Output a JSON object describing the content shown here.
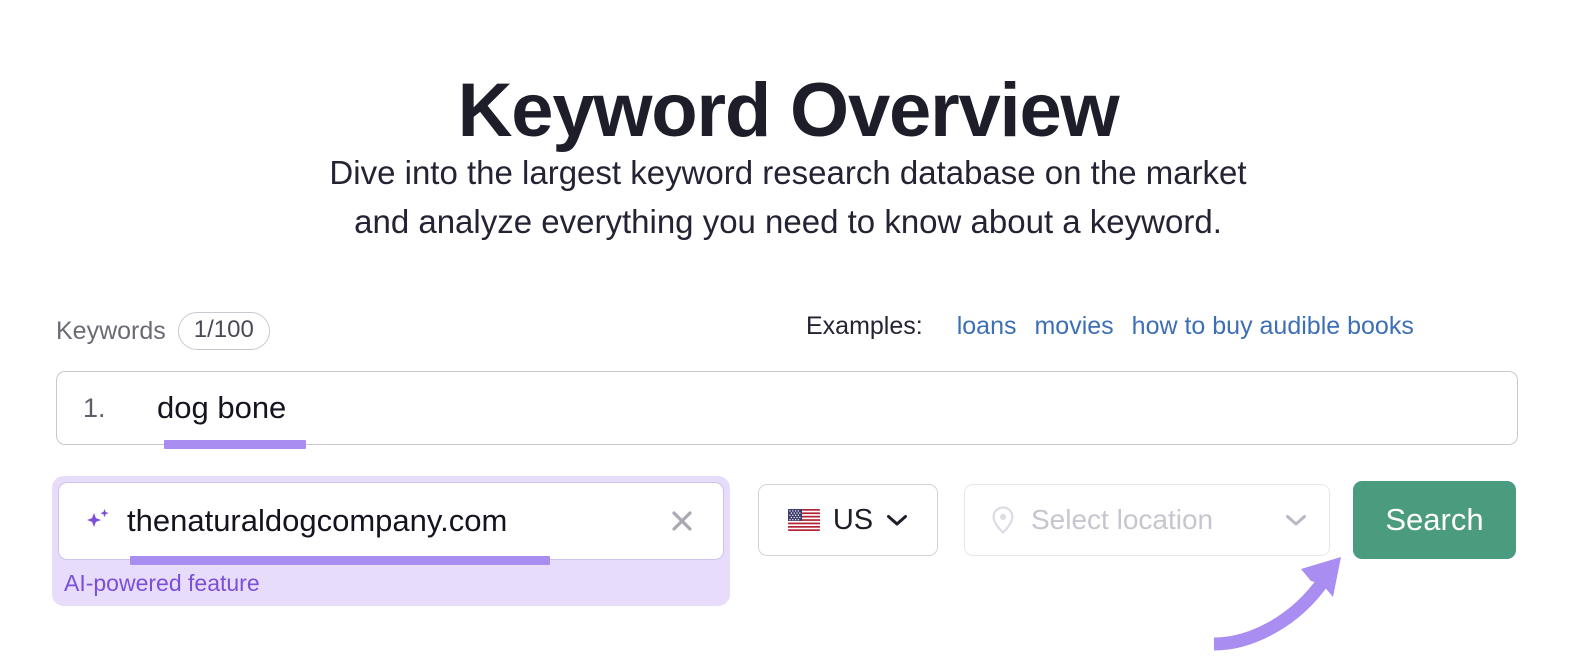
{
  "header": {
    "title": "Keyword Overview",
    "subtitle_line1": "Dive into the largest keyword research database on the market",
    "subtitle_line2": "and analyze everything you need to know about a keyword."
  },
  "keywords_section": {
    "label": "Keywords",
    "count_badge": "1/100",
    "rows": [
      {
        "index": "1.",
        "value": "dog bone"
      }
    ]
  },
  "examples": {
    "label": "Examples:",
    "items": [
      "loans",
      "movies",
      "how to buy audible books"
    ]
  },
  "ai_domain_field": {
    "icon": "sparkle-icon",
    "value": "thenaturaldogcompany.com",
    "clear_icon": "close-icon",
    "note": "AI-powered feature"
  },
  "country_select": {
    "flag": "us-flag-icon",
    "value": "US",
    "chevron": "chevron-down-icon"
  },
  "location_select": {
    "icon": "map-pin-icon",
    "placeholder": "Select location",
    "chevron": "chevron-down-icon"
  },
  "search_button": {
    "label": "Search"
  },
  "annotation": {
    "type": "curved-arrow",
    "points_to": "search-button"
  },
  "colors": {
    "accent_purple": "#a98df0",
    "ai_purple_text": "#7b4fd8",
    "ai_panel_bg": "#e7dcfa",
    "search_green": "#4b9b7e",
    "link_blue": "#3d6fb6",
    "title_dark": "#1d1e29"
  }
}
